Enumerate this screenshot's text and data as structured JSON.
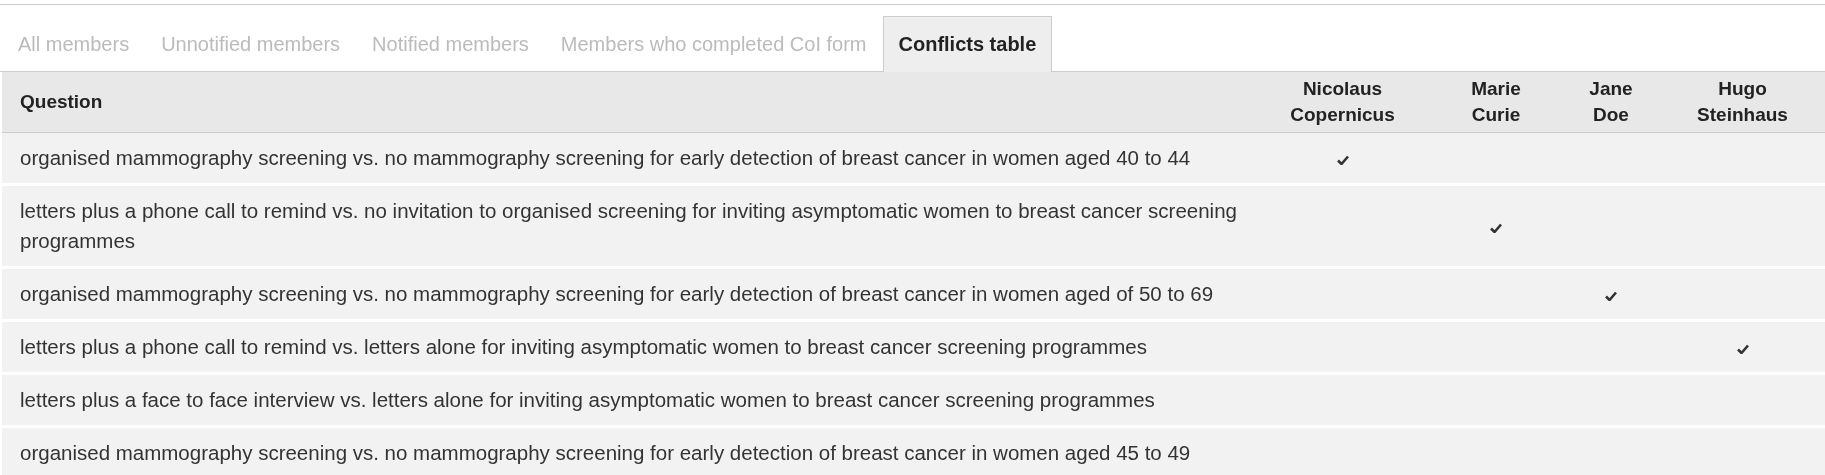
{
  "tabs": [
    {
      "label": "All members",
      "selected": false
    },
    {
      "label": "Unnotified members",
      "selected": false
    },
    {
      "label": "Notified members",
      "selected": false
    },
    {
      "label": "Members who completed CoI form",
      "selected": false
    },
    {
      "label": "Conflicts table",
      "selected": true
    }
  ],
  "table": {
    "columns": [
      "Question",
      "Nicolaus Copernicus",
      "Marie Curie",
      "Jane Doe",
      "Hugo Steinhaus"
    ],
    "rows": [
      {
        "question": "organised mammography screening vs. no mammography screening for early detection of breast cancer in women aged 40 to 44",
        "checks": [
          true,
          false,
          false,
          false
        ]
      },
      {
        "question": "letters plus a phone call to remind vs. no invitation to organised screening for inviting asymptomatic women to breast cancer screening programmes",
        "checks": [
          false,
          true,
          false,
          false
        ]
      },
      {
        "question": "organised mammography screening vs. no mammography screening for early detection of breast cancer in women aged of 50 to 69",
        "checks": [
          false,
          false,
          true,
          false
        ]
      },
      {
        "question": "letters plus a phone call to remind vs. letters alone for inviting asymptomatic women to breast cancer screening programmes",
        "checks": [
          false,
          false,
          false,
          true
        ]
      },
      {
        "question": "letters plus a face to face interview vs. letters alone for inviting asymptomatic women to breast cancer screening programmes",
        "checks": [
          false,
          false,
          false,
          false
        ]
      },
      {
        "question": "organised mammography screening vs. no mammography screening for early detection of breast cancer in women aged 45 to 49",
        "checks": [
          false,
          false,
          false,
          false
        ]
      }
    ]
  }
}
